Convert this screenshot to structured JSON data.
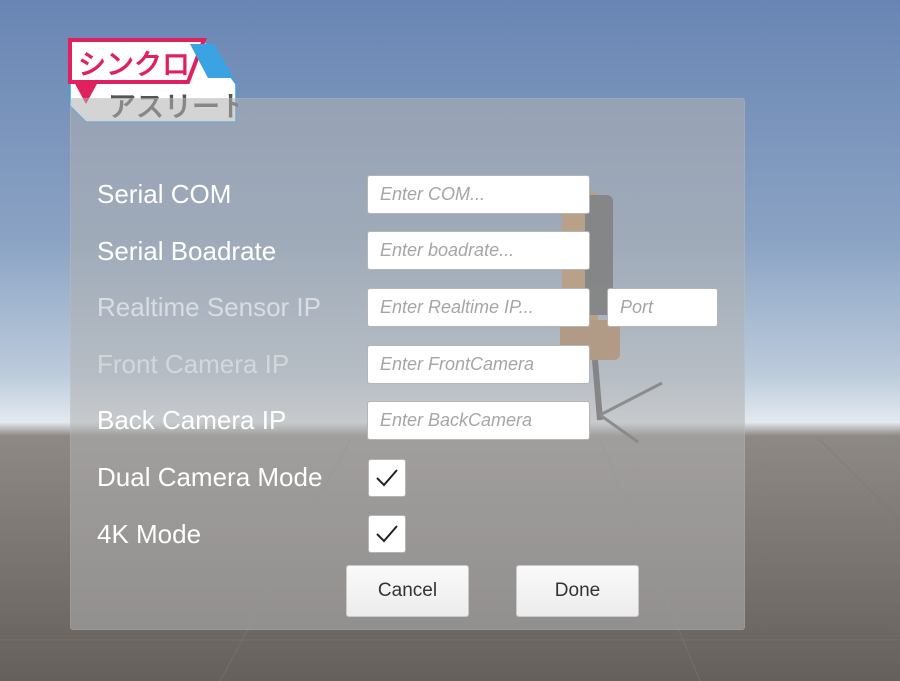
{
  "logo": {
    "line1": "シンクロ",
    "line2": "アスリート"
  },
  "form": {
    "serial_com": {
      "label": "Serial COM",
      "placeholder": "Enter COM..."
    },
    "serial_baudrate": {
      "label": "Serial Boadrate",
      "placeholder": "Enter boadrate..."
    },
    "realtime_sensor_ip": {
      "label": "Realtime Sensor IP",
      "placeholder": "Enter Realtime IP...",
      "port_placeholder": "Port"
    },
    "front_camera_ip": {
      "label": "Front Camera IP",
      "placeholder": "Enter FrontCamera"
    },
    "back_camera_ip": {
      "label": "Back Camera IP",
      "placeholder": "Enter BackCamera"
    },
    "dual_camera_mode": {
      "label": "Dual Camera Mode",
      "checked": true
    },
    "mode_4k": {
      "label": "4K Mode",
      "checked": true
    }
  },
  "buttons": {
    "cancel": "Cancel",
    "done": "Done"
  },
  "colors": {
    "sky_top": "#6b88b4",
    "sky_horizon": "#d9e2ea",
    "ground": "#6e6863",
    "panel": "#b0b0b0",
    "logo_pink": "#e0215f",
    "logo_blue": "#3ba3e2",
    "chair_orange": "#c78a4e"
  }
}
